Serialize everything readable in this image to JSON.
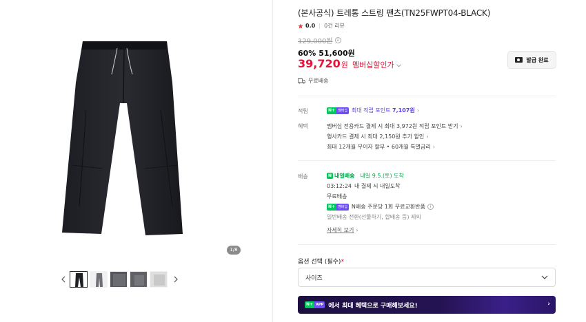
{
  "product": {
    "title": "(본사공식) 트레통 스트링 팬츠(TN25FWPT04-BLACK)",
    "rating": "0.0",
    "reviews": "0건 리뷰",
    "original_price": "129,000원",
    "discount": "60%",
    "sale_price": "51,600원",
    "member_price": "39,720",
    "member_won": "원",
    "member_label": "멤버십할인가",
    "coupon_button": "발급 완료",
    "shipping_free": "무료배송"
  },
  "gallery": {
    "page_badge": "1/8",
    "thumbnails": [
      "thumb-1",
      "thumb-2",
      "thumb-3",
      "thumb-4",
      "thumb-5"
    ]
  },
  "points": {
    "label": "적립",
    "npay_logo": "N+",
    "npay_member": "멤버십",
    "text": "최대 적립 포인트",
    "amount": "7,107원"
  },
  "benefits": {
    "label": "혜택",
    "lines": [
      "멤버십 전용카드 결제 시 최대 3,972원 적립 포인트 받기",
      "행사카드 결제 시 최대 2,150원 추가 할인",
      "최대 12개월 무이자 할부 • 60개월 특별금리"
    ]
  },
  "delivery": {
    "label": "배송",
    "fast_badge": "내일배송",
    "arrival": "내일 9.5.(토) 도착",
    "deadline": "03:12:24",
    "deadline_text": "내 결제 시 내일도착",
    "free": "무료배송",
    "exchange": "N배송 주문당 1회 무료교환반품",
    "exception": "일반배송 전환(선물하기, 합배송 등) 제외",
    "more": "자세히 보기"
  },
  "options": {
    "title": "옵션 선택",
    "required": "(필수)",
    "asterisk": "*",
    "select_value": "사이즈"
  },
  "banner": {
    "tag_n": "N+",
    "tag_app": "APP",
    "text": "에서 최대 혜택으로 구매해보세요!"
  },
  "colors": {
    "accent_red": "#e0163a",
    "npay_green": "#03c75a",
    "point_purple": "#5a3fe6"
  }
}
